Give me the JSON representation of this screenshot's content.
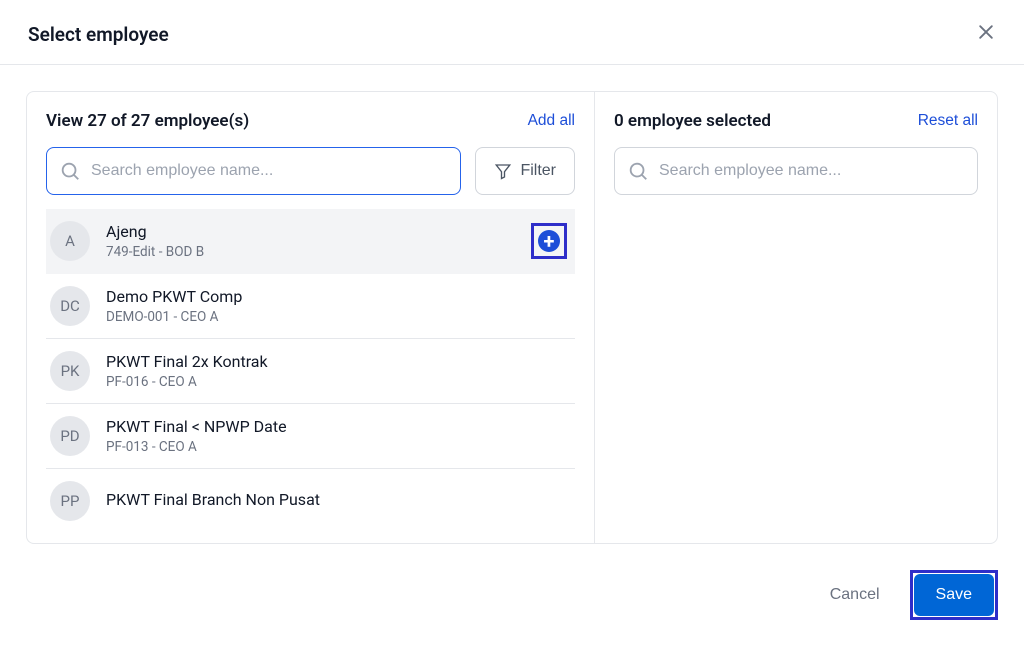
{
  "modal": {
    "title": "Select employee",
    "cancel_label": "Cancel",
    "save_label": "Save"
  },
  "left_panel": {
    "count_text": "View 27 of 27 employee(s)",
    "action_label": "Add all",
    "search_placeholder": "Search employee name...",
    "filter_label": "Filter",
    "employees": [
      {
        "initials": "A",
        "name": "Ajeng",
        "detail": "749-Edit - BOD B",
        "hover": true
      },
      {
        "initials": "DC",
        "name": "Demo PKWT Comp",
        "detail": "DEMO-001 - CEO A",
        "hover": false
      },
      {
        "initials": "PK",
        "name": "PKWT Final 2x Kontrak",
        "detail": "PF-016 - CEO A",
        "hover": false
      },
      {
        "initials": "PD",
        "name": "PKWT Final < NPWP Date",
        "detail": "PF-013 - CEO A",
        "hover": false
      },
      {
        "initials": "PP",
        "name": "PKWT Final Branch Non Pusat",
        "detail": "",
        "hover": false
      }
    ]
  },
  "right_panel": {
    "count_text": "0 employee selected",
    "action_label": "Reset all",
    "search_placeholder": "Search employee name..."
  }
}
